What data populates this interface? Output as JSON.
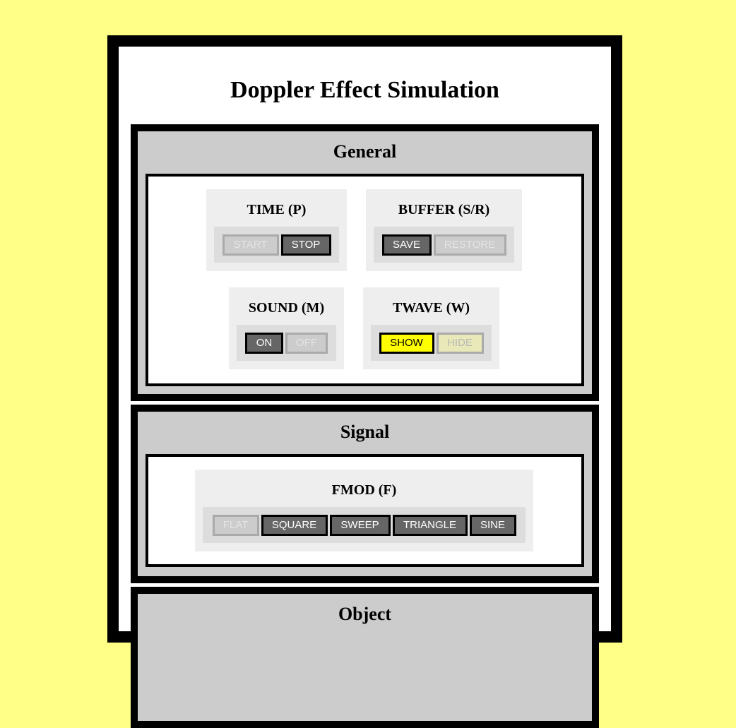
{
  "page": {
    "title": "Doppler Effect Simulation"
  },
  "sections": {
    "general": {
      "title": "General",
      "time": {
        "title": "TIME (P)",
        "start": "START",
        "stop": "STOP"
      },
      "buffer": {
        "title": "BUFFER (S/R)",
        "save": "SAVE",
        "restore": "RESTORE"
      },
      "sound": {
        "title": "SOUND (M)",
        "on": "ON",
        "off": "OFF"
      },
      "twave": {
        "title": "TWAVE (W)",
        "show": "SHOW",
        "hide": "HIDE"
      }
    },
    "signal": {
      "title": "Signal",
      "fmod": {
        "title": "FMOD (F)",
        "flat": "FLAT",
        "square": "SQUARE",
        "sweep": "SWEEP",
        "triangle": "TRIANGLE",
        "sine": "SINE"
      }
    },
    "object": {
      "title": "Object"
    }
  },
  "colors": {
    "background": "#ffff88",
    "frame": "#000000",
    "section": "#cccccc",
    "active_button": "#666666",
    "highlight_button": "#ffff00"
  }
}
